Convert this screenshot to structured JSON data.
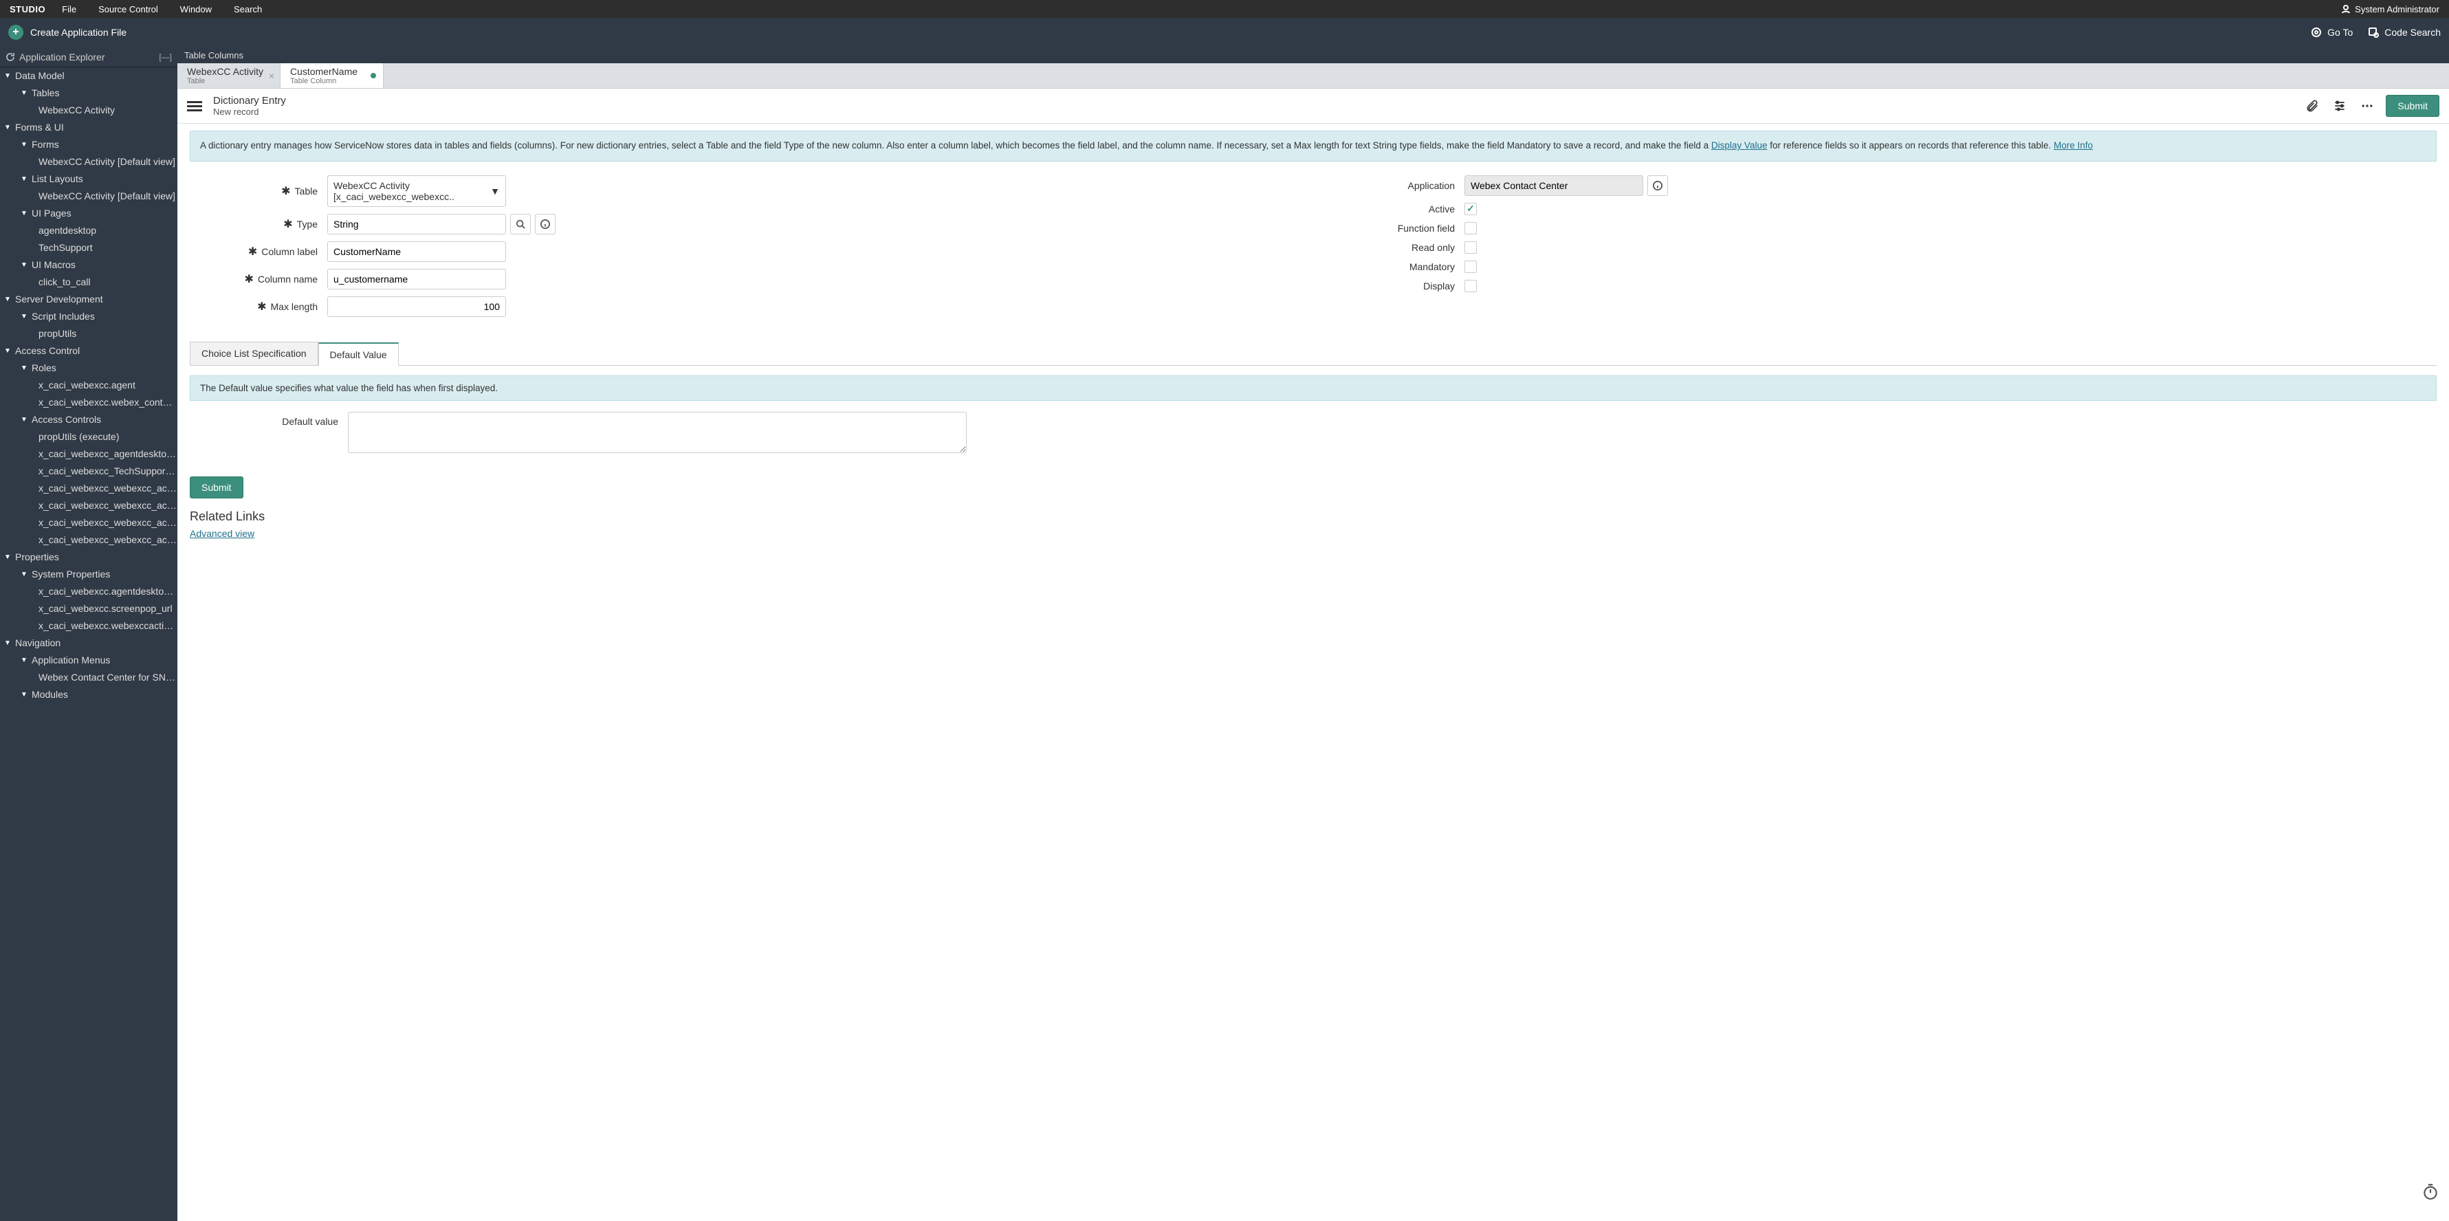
{
  "menubar": {
    "brand": "STUDIO",
    "items": [
      "File",
      "Source Control",
      "Window",
      "Search"
    ],
    "user_label": "System Administrator"
  },
  "subbar": {
    "create_label": "Create Application File",
    "goto_label": "Go To",
    "codesearch_label": "Code Search"
  },
  "sidebar": {
    "header": "Application Explorer",
    "collapse_label": "[—]",
    "tree": [
      {
        "lvl": 1,
        "caret": true,
        "label": "Data Model"
      },
      {
        "lvl": 2,
        "caret": true,
        "label": "Tables"
      },
      {
        "lvl": 3,
        "label": "WebexCC Activity"
      },
      {
        "lvl": 1,
        "caret": true,
        "label": "Forms & UI"
      },
      {
        "lvl": 2,
        "caret": true,
        "label": "Forms"
      },
      {
        "lvl": 3,
        "label": "WebexCC Activity [Default view]"
      },
      {
        "lvl": 2,
        "caret": true,
        "label": "List Layouts"
      },
      {
        "lvl": 3,
        "label": "WebexCC Activity [Default view]"
      },
      {
        "lvl": 2,
        "caret": true,
        "label": "UI Pages"
      },
      {
        "lvl": 3,
        "label": "agentdesktop"
      },
      {
        "lvl": 3,
        "label": "TechSupport"
      },
      {
        "lvl": 2,
        "caret": true,
        "label": "UI Macros"
      },
      {
        "lvl": 3,
        "label": "click_to_call"
      },
      {
        "lvl": 1,
        "caret": true,
        "label": "Server Development"
      },
      {
        "lvl": 2,
        "caret": true,
        "label": "Script Includes"
      },
      {
        "lvl": 3,
        "label": "propUtils"
      },
      {
        "lvl": 1,
        "caret": true,
        "label": "Access Control"
      },
      {
        "lvl": 2,
        "caret": true,
        "label": "Roles"
      },
      {
        "lvl": 3,
        "label": "x_caci_webexcc.agent"
      },
      {
        "lvl": 3,
        "label": "x_caci_webexcc.webex_contact_center"
      },
      {
        "lvl": 2,
        "caret": true,
        "label": "Access Controls"
      },
      {
        "lvl": 3,
        "label": "propUtils (execute)"
      },
      {
        "lvl": 3,
        "label": "x_caci_webexcc_agentdesktop (read)"
      },
      {
        "lvl": 3,
        "label": "x_caci_webexcc_TechSupport (read)"
      },
      {
        "lvl": 3,
        "label": "x_caci_webexcc_webexcc_activity (delete)"
      },
      {
        "lvl": 3,
        "label": "x_caci_webexcc_webexcc_activity (create)"
      },
      {
        "lvl": 3,
        "label": "x_caci_webexcc_webexcc_activity (read)"
      },
      {
        "lvl": 3,
        "label": "x_caci_webexcc_webexcc_activity (write)"
      },
      {
        "lvl": 1,
        "caret": true,
        "label": "Properties"
      },
      {
        "lvl": 2,
        "caret": true,
        "label": "System Properties"
      },
      {
        "lvl": 3,
        "label": "x_caci_webexcc.agentdesktop_url"
      },
      {
        "lvl": 3,
        "label": "x_caci_webexcc.screenpop_url"
      },
      {
        "lvl": 3,
        "label": "x_caci_webexcc.webexccactivitytable"
      },
      {
        "lvl": 1,
        "caret": true,
        "label": "Navigation"
      },
      {
        "lvl": 2,
        "caret": true,
        "label": "Application Menus"
      },
      {
        "lvl": 3,
        "label": "Webex Contact Center for SNOW"
      },
      {
        "lvl": 2,
        "caret": true,
        "label": "Modules"
      }
    ]
  },
  "crumb": "Table Columns",
  "tabs": [
    {
      "title": "WebexCC Activity",
      "sub": "Table",
      "active": false,
      "closeable": true,
      "dirty": false
    },
    {
      "title": "CustomerName",
      "sub": "Table Column",
      "active": true,
      "closeable": false,
      "dirty": true
    }
  ],
  "form_header": {
    "title": "Dictionary Entry",
    "sub": "New record",
    "submit": "Submit"
  },
  "banner": {
    "p1": "A dictionary entry manages how ServiceNow stores data in tables and fields (columns). For new dictionary entries, select a Table and the field Type of the new column. Also enter a column label, which becomes the field label, and the column name. If necessary, set a Max length for text String type fields, make the field Mandatory to save a record, and make the field a ",
    "link1": "Display Value",
    "p2": " for reference fields so it appears on records that reference this table. ",
    "link2": "More Info"
  },
  "fields": {
    "table_label": "Table",
    "table_value": "WebexCC Activity [x_caci_webexcc_webexcc..",
    "type_label": "Type",
    "type_value": "String",
    "col_label_label": "Column label",
    "col_label_value": "CustomerName",
    "col_name_label": "Column name",
    "col_name_value": "u_customername",
    "maxlen_label": "Max length",
    "maxlen_value": "100",
    "app_label": "Application",
    "app_value": "Webex Contact Center",
    "active_label": "Active",
    "ff_label": "Function field",
    "ro_label": "Read only",
    "mand_label": "Mandatory",
    "disp_label": "Display"
  },
  "subtabs": {
    "choice": "Choice List Specification",
    "default": "Default Value"
  },
  "default_panel": {
    "banner": "The Default value specifies what value the field has when first displayed.",
    "label": "Default value",
    "value": ""
  },
  "footer": {
    "submit": "Submit",
    "related": "Related Links",
    "advanced": "Advanced view"
  }
}
